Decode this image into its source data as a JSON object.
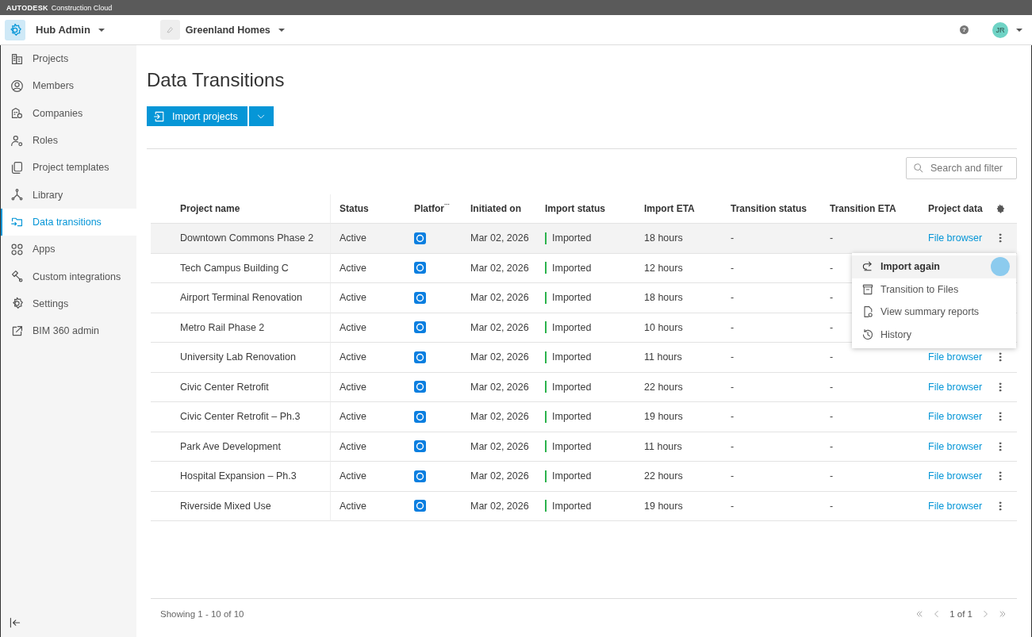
{
  "brand": {
    "name": "AUTODESK",
    "product": "Construction Cloud"
  },
  "header": {
    "hub": "Hub Admin",
    "account": "Greenland Homes",
    "help": "?",
    "avatar": "JR"
  },
  "sidebar": {
    "items": [
      {
        "label": "Projects",
        "selected": false
      },
      {
        "label": "Members",
        "selected": false
      },
      {
        "label": "Companies",
        "selected": false
      },
      {
        "label": "Roles",
        "selected": false
      },
      {
        "label": "Project templates",
        "selected": false
      },
      {
        "label": "Library",
        "selected": false
      },
      {
        "label": "Data transitions",
        "selected": true
      },
      {
        "label": "Apps",
        "selected": false
      },
      {
        "label": "Custom integrations",
        "selected": false
      },
      {
        "label": "Settings",
        "selected": false
      },
      {
        "label": "BIM 360 admin",
        "selected": false
      }
    ]
  },
  "page": {
    "title": "Data Transitions",
    "primary_button": "Import projects",
    "search": {
      "placeholder": "Search and filter"
    }
  },
  "table": {
    "columns": [
      {
        "label": "Project name"
      },
      {
        "label": "Status"
      },
      {
        "label": "Platfor",
        "overflow_mark": "..."
      },
      {
        "label": "Initiated on"
      },
      {
        "label": "Import status"
      },
      {
        "label": "Import ETA"
      },
      {
        "label": "Transition status"
      },
      {
        "label": "Transition ETA"
      },
      {
        "label": "Project data"
      }
    ],
    "rows": [
      {
        "name": "Downtown Commons Phase 2",
        "status": "Active",
        "initiated": "Mar 02, 2026",
        "import_status": "Imported",
        "import_eta": "18 hours",
        "transition_status": "-",
        "transition_eta": "-",
        "project_data": "File browser",
        "highlighted": true
      },
      {
        "name": "Tech Campus Building C",
        "status": "Active",
        "initiated": "Mar 02, 2026",
        "import_status": "Imported",
        "import_eta": "12 hours",
        "transition_status": "-",
        "transition_eta": "-",
        "highlighted": false
      },
      {
        "name": "Airport Terminal Renovation",
        "status": "Active",
        "initiated": "Mar 02, 2026",
        "import_status": "Imported",
        "import_eta": "18 hours",
        "transition_status": "-",
        "transition_eta": "-",
        "highlighted": false
      },
      {
        "name": "Metro Rail Phase 2",
        "status": "Active",
        "initiated": "Mar 02, 2026",
        "import_status": "Imported",
        "import_eta": "10 hours",
        "transition_status": "-",
        "transition_eta": "-",
        "highlighted": false
      },
      {
        "name": "University Lab Renovation",
        "status": "Active",
        "initiated": "Mar 02, 2026",
        "import_status": "Imported",
        "import_eta": "11 hours",
        "transition_status": "-",
        "transition_eta": "-",
        "project_data": "File browser",
        "highlighted": false
      },
      {
        "name": "Civic Center Retrofit",
        "status": "Active",
        "initiated": "Mar 02, 2026",
        "import_status": "Imported",
        "import_eta": "22 hours",
        "transition_status": "-",
        "transition_eta": "-",
        "project_data": "File browser",
        "highlighted": false
      },
      {
        "name": "Civic Center Retrofit  – Ph.3",
        "status": "Active",
        "initiated": "Mar 02, 2026",
        "import_status": "Imported",
        "import_eta": "19 hours",
        "transition_status": "-",
        "transition_eta": "-",
        "project_data": "File browser",
        "highlighted": false
      },
      {
        "name": "Park Ave Development",
        "status": "Active",
        "initiated": "Mar 02, 2026",
        "import_status": "Imported",
        "import_eta": "11 hours",
        "transition_status": "-",
        "transition_eta": "-",
        "project_data": "File browser",
        "highlighted": false
      },
      {
        "name": "Hospital Expansion – Ph.3",
        "status": "Active",
        "initiated": "Mar 02, 2026",
        "import_status": "Imported",
        "import_eta": "22 hours",
        "transition_status": "-",
        "transition_eta": "-",
        "project_data": "File browser",
        "highlighted": false
      },
      {
        "name": "Riverside Mixed Use",
        "status": "Active",
        "initiated": "Mar 02, 2026",
        "import_status": "Imported",
        "import_eta": "19 hours",
        "transition_status": "-",
        "transition_eta": "-",
        "project_data": "File browser",
        "highlighted": false
      }
    ]
  },
  "context_menu": {
    "items": [
      {
        "label": "Import again",
        "highlighted": true
      },
      {
        "label": "Transition to Files",
        "highlighted": false
      },
      {
        "label": "View summary reports",
        "highlighted": false
      },
      {
        "label": "History",
        "highlighted": false
      }
    ]
  },
  "footer": {
    "showing": "Showing 1 - 10 of 10",
    "page": "1 of 1"
  }
}
